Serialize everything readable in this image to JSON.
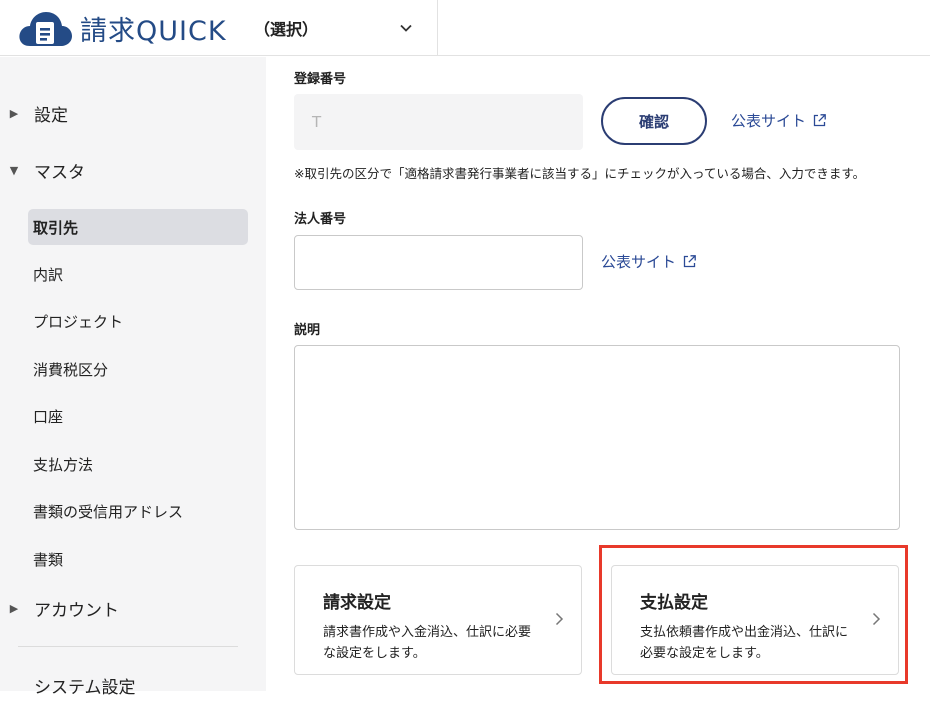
{
  "header": {
    "brand": "請求QUICK",
    "org_select": "（選択）"
  },
  "sidebar": {
    "sections": [
      {
        "label": "設定",
        "expanded": false
      },
      {
        "label": "マスタ",
        "expanded": true
      },
      {
        "label": "アカウント",
        "expanded": false
      }
    ],
    "items": [
      {
        "label": "取引先",
        "active": true
      },
      {
        "label": "内訳"
      },
      {
        "label": "プロジェクト"
      },
      {
        "label": "消費税区分"
      },
      {
        "label": "口座"
      },
      {
        "label": "支払方法"
      },
      {
        "label": "書類の受信用アドレス"
      },
      {
        "label": "書類"
      }
    ],
    "footer_item": "システム設定"
  },
  "form": {
    "registration_label": "登録番号",
    "registration_value": "T",
    "confirm_button": "確認",
    "public_site_link": "公表サイト",
    "registration_note": "※取引先の区分で「適格請求書発行事業者に該当する」にチェックが入っている場合、入力できます。",
    "corporate_number_label": "法人番号",
    "corporate_number_value": "",
    "description_label": "説明",
    "description_value": ""
  },
  "cards": [
    {
      "title": "請求設定",
      "desc": "請求書作成や入金消込、仕訳に必要な設定をします。"
    },
    {
      "title": "支払設定",
      "desc": "支払依頼書作成や出金消込、仕訳に必要な設定をします。"
    }
  ],
  "colors": {
    "brand": "#244b86",
    "accent": "#2b3d73",
    "link": "#2b4a96",
    "highlight": "#e8392a"
  }
}
